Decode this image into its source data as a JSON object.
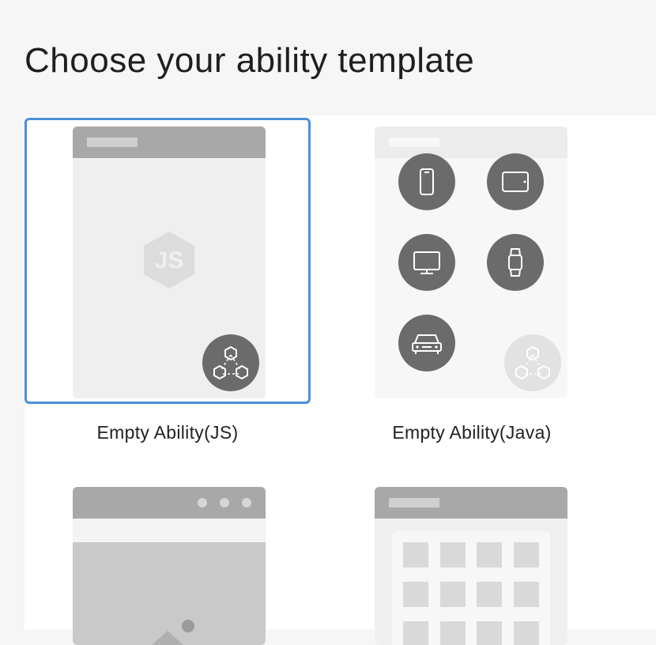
{
  "page": {
    "title": "Choose your ability template"
  },
  "templates": [
    {
      "label": "Empty Ability(JS)",
      "selected": true,
      "js_badge": "JS"
    },
    {
      "label": "Empty Ability(Java)",
      "selected": false
    },
    {
      "label": "",
      "selected": false
    },
    {
      "label": "",
      "selected": false
    }
  ],
  "colors": {
    "selection_border": "#4a90d9",
    "device_icon_bg": "#6b6b6b",
    "thumb_bar": "#a8a8a8"
  },
  "icons": [
    "js-hexagon-icon",
    "distributed-nodes-icon",
    "phone-icon",
    "tablet-icon",
    "tv-icon",
    "watch-icon",
    "car-icon"
  ]
}
